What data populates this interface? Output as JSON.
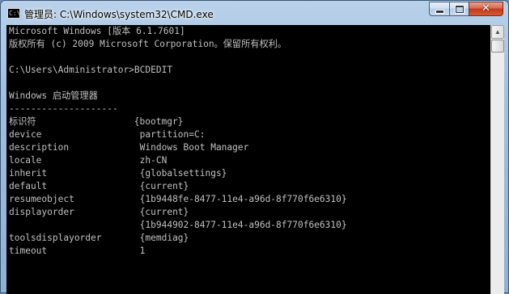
{
  "window": {
    "title": "管理员: C:\\Windows\\system32\\CMD.exe",
    "icon_text": "C:\\",
    "buttons": {
      "minimize": "minimize-icon",
      "maximize": "maximize-icon",
      "close": "close-icon"
    }
  },
  "console": {
    "lines": [
      "Microsoft Windows [版本 6.1.7601]",
      "版权所有 (c) 2009 Microsoft Corporation。保留所有权利。",
      "",
      "C:\\Users\\Administrator>BCDEDIT",
      "",
      "Windows 启动管理器",
      "--------------------",
      "标识符                  {bootmgr}",
      "device                  partition=C:",
      "description             Windows Boot Manager",
      "locale                  zh-CN",
      "inherit                 {globalsettings}",
      "default                 {current}",
      "resumeobject            {1b9448fe-8477-11e4-a96d-8f770f6e6310}",
      "displayorder            {current}",
      "                        {1b944902-8477-11e4-a96d-8f770f6e6310}",
      "toolsdisplayorder       {memdiag}",
      "timeout                 1"
    ]
  },
  "colors": {
    "console_bg": "#000000",
    "console_text": "#c0c0c0",
    "close_button": "#c23a1c"
  }
}
